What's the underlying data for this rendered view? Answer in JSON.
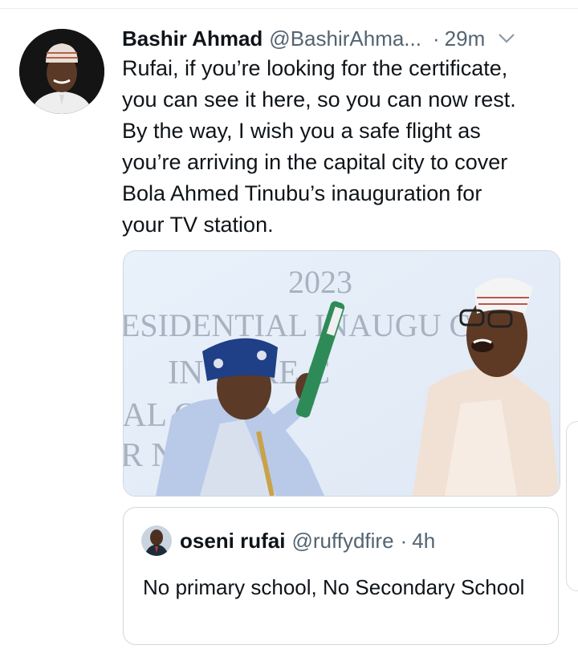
{
  "tweet": {
    "author_name": "Bashir Ahmad",
    "author_handle": "@BashirAhma...",
    "separator": "·",
    "time": "29m",
    "text": "Rufai, if you’re looking for the certificate,\nyou can see it here, so you can now rest.\nBy the way, I wish you a safe flight as\nyou’re arriving in the capital city to cover\nBola Ahmed Tinubu’s inauguration for\nyour TV station.",
    "media": {
      "backdrop_lines": [
        "2023",
        "ESIDENTIAL INAUGU  C",
        "IN    TURE C",
        "AL    OURS",
        "R      NSIT"
      ]
    }
  },
  "quoted_tweet": {
    "author_name": "oseni rufai",
    "author_handle": "@ruffydfire",
    "separator": "·",
    "time": "4h",
    "text": "No primary school, No Secondary School"
  },
  "colors": {
    "text_primary": "#0f1419",
    "text_secondary": "#536471",
    "border": "#cfd9de",
    "backdrop_text": "#a8b2c0"
  }
}
